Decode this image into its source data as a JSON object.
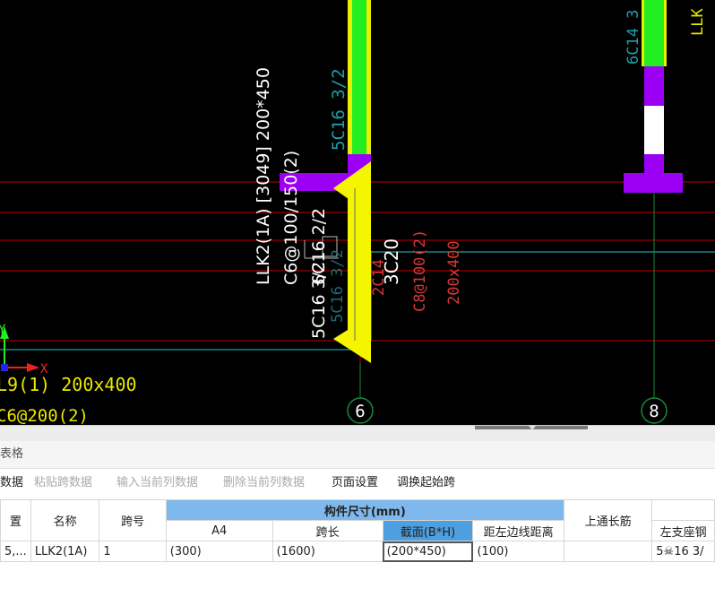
{
  "cad": {
    "beam_main_label": "LLK2(1A) [3049] 200*450",
    "beam_stirrup_label": "C6@100/150(2)",
    "beam_bottom_label": "5C16 3/2",
    "beam_side_label": "6C16 2/2",
    "faint_overlap_label": "5C16 3/2",
    "cyan_top_label": "5C16 3/2",
    "col_bar_label": "2C14",
    "col_bar_label2": "3C20",
    "red_stirrup_label": "C8@100(2)",
    "red_size_label": "200x400",
    "left_beam_label": "L9(1) 200x400",
    "left_stirrup_label": "C6@200(2)",
    "right_top_cyan": "6C14 3",
    "right_top_yellow": "LLK",
    "axis_y": "Y",
    "axis_x": "X",
    "grid_6": "6",
    "grid_8": "8"
  },
  "panel": {
    "title": "表格"
  },
  "toolbar": {
    "items": [
      {
        "label": "数据",
        "enabled": true
      },
      {
        "label": "粘贴跨数据",
        "enabled": false
      },
      {
        "label": "输入当前列数据",
        "enabled": false
      },
      {
        "label": "删除当前列数据",
        "enabled": false
      },
      {
        "label": "页面设置",
        "enabled": true
      },
      {
        "label": "调换起始跨",
        "enabled": true
      }
    ]
  },
  "table": {
    "group_header": "构件尺寸(mm)",
    "headers": {
      "c0": "置",
      "name": "名称",
      "span_no": "跨号",
      "a4": "A4",
      "span_len": "跨长",
      "section": "截面(B*H)",
      "dist": "距左边线距离",
      "top_bar": "上通长筋",
      "left_seat": "左支座钢"
    },
    "row": {
      "c0": "5,...",
      "name": "LLK2(1A)",
      "span_no": "1",
      "a4": "(300)",
      "span_len": "(1600)",
      "section": "(200*450)",
      "dist": "(100)",
      "top_bar": "",
      "left_seat": "5☠16 3/"
    }
  }
}
